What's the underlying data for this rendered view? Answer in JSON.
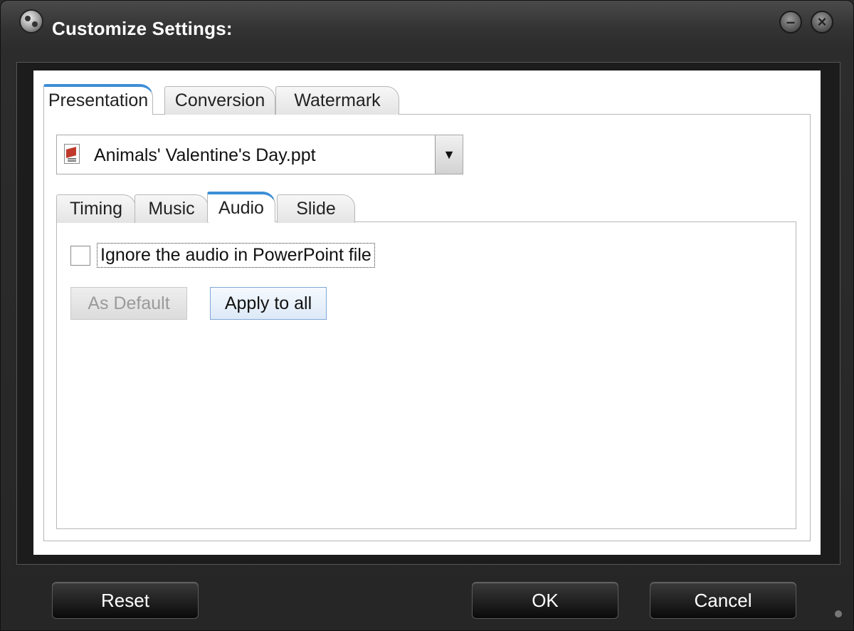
{
  "window": {
    "title": "Customize Settings:",
    "icon": "app-reel-icon",
    "minimize_icon": "minimize-icon",
    "close_icon": "close-icon"
  },
  "outer_tabs": [
    {
      "label": "Presentation",
      "active": true
    },
    {
      "label": "Conversion",
      "active": false
    },
    {
      "label": "Watermark",
      "active": false
    }
  ],
  "file_select": {
    "value": "Animals' Valentine's Day.ppt",
    "icon": "ppt-file-icon"
  },
  "inner_tabs": [
    {
      "label": "Timing",
      "active": false
    },
    {
      "label": "Music",
      "active": false
    },
    {
      "label": "Audio",
      "active": true
    },
    {
      "label": "Slide",
      "active": false
    }
  ],
  "audio": {
    "ignore_audio_label": "Ignore the audio in PowerPoint file",
    "ignore_audio_checked": false,
    "as_default_label": "As Default",
    "apply_to_all_label": "Apply to all"
  },
  "footer": {
    "reset_label": "Reset",
    "ok_label": "OK",
    "cancel_label": "Cancel"
  },
  "colors": {
    "active_tab_accent": "#3d8ed6",
    "frame_dark": "#2c2c2c"
  }
}
